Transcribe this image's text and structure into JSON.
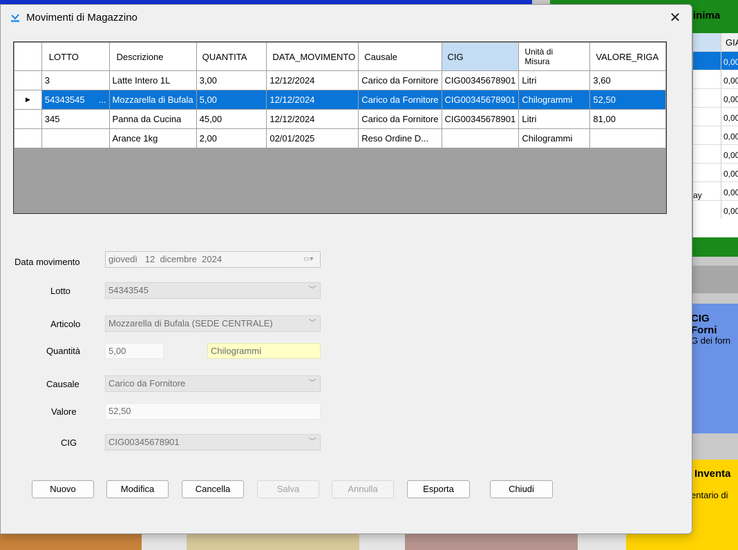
{
  "window": {
    "title": "Movimenti di Magazzino"
  },
  "grid": {
    "headers": [
      "LOTTO",
      "Descrizione",
      "QUANTITA",
      "DATA_MOVIMENTO",
      "Causale",
      "CIG",
      "Unità di",
      "Misura",
      "VALORE_RIGA"
    ],
    "rows": [
      [
        "3",
        "Latte Intero 1L",
        "3,00",
        "12/12/2024",
        "Carico da Fornitore",
        "CIG00345678901",
        "Litri",
        "3,60"
      ],
      [
        "54343545",
        "Mozzarella di Bufala",
        "5,00",
        "12/12/2024",
        "Carico da Fornitore",
        "CIG00345678901",
        "Chilogrammi",
        "52,50"
      ],
      [
        "345",
        "Panna da Cucina",
        "45,00",
        "12/12/2024",
        "Carico da Fornitore",
        "CIG00345678901",
        "Litri",
        "81,00"
      ],
      [
        "",
        "Arance 1kg",
        "2,00",
        "02/01/2025",
        "Reso Ordine D...",
        "",
        "Chilogrammi",
        ""
      ]
    ],
    "selected_row_ellipsis": "...",
    "selected_marker": "▶"
  },
  "form": {
    "data_label": "Data movimento",
    "data_value": "giovedì   12  dicembre  2024",
    "lotto_label": "Lotto",
    "lotto_value": "54343545",
    "articolo_label": "Articolo",
    "articolo_value": "Mozzarella di Bufala (SEDE CENTRALE)",
    "quantita_label": "Quantità",
    "quantita_value": "5,00",
    "unita_value": "Chilogrammi",
    "causale_label": "Causale",
    "causale_value": "Carico da Fornitore",
    "valore_label": "Valore",
    "valore_value": "52,50",
    "cig_label": "CIG",
    "cig_value": "CIG00345678901"
  },
  "buttons": {
    "nuovo": "Nuovo",
    "modifica": "Modifica",
    "cancella": "Cancella",
    "salva": "Salva",
    "annulla": "Annulla",
    "esporta": "Esporta",
    "chiudi": "Chiudi"
  },
  "background": {
    "title_right": "inima",
    "grid_head": "GIA",
    "grid_values": [
      "0,00",
      "0,00",
      "0,00",
      "0,00",
      "0,00",
      "0,00",
      "0,00",
      "0,00",
      "0,00"
    ],
    "ay_text": "ay",
    "blue_title": "CIG Forni",
    "blue_sub": "G dei forn",
    "yellow_title": "Inventa",
    "yellow_sub": "entario di"
  },
  "colors": {
    "selection": "#0a75d8",
    "cig_header": "#c4ddf4",
    "unita_highlight": "#ffffc6"
  }
}
